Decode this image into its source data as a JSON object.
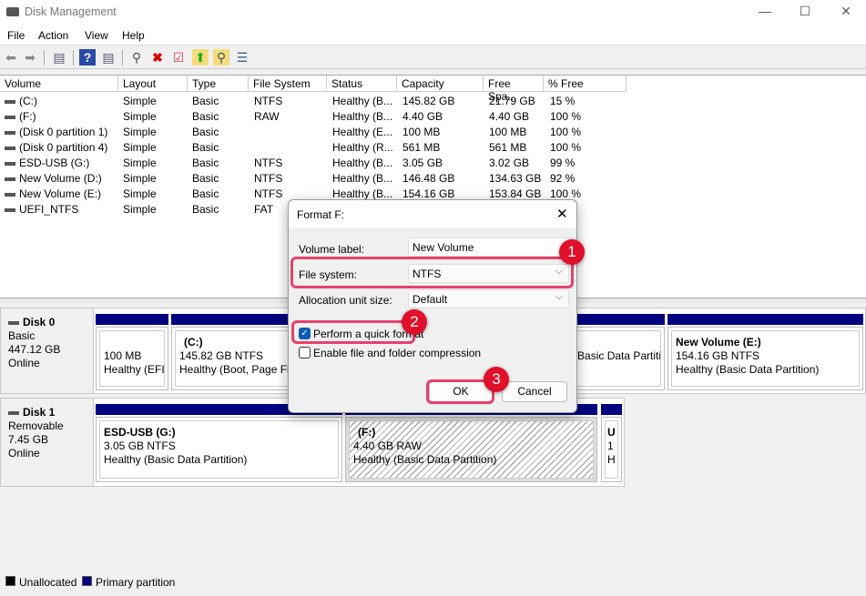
{
  "window": {
    "title": "Disk Management",
    "minimize": "—",
    "maximize": "☐",
    "close": "✕"
  },
  "menu": [
    "File",
    "Action",
    "View",
    "Help"
  ],
  "toolbar": [
    "back-icon",
    "forward-icon",
    "console-tree-icon",
    "help-icon",
    "action-pane-icon",
    "connect-disk-icon",
    "delete-icon",
    "properties-icon",
    "open-folder-icon",
    "explore-icon",
    "list-icon"
  ],
  "columns": [
    "Volume",
    "Layout",
    "Type",
    "File System",
    "Status",
    "Capacity",
    "Free Spa...",
    "% Free"
  ],
  "volumes": [
    [
      "(C:)",
      "Simple",
      "Basic",
      "NTFS",
      "Healthy (B...",
      "145.82 GB",
      "21.79 GB",
      "15 %"
    ],
    [
      "(F:)",
      "Simple",
      "Basic",
      "RAW",
      "Healthy (B...",
      "4.40 GB",
      "4.40 GB",
      "100 %"
    ],
    [
      "(Disk 0 partition 1)",
      "Simple",
      "Basic",
      "",
      "Healthy (E...",
      "100 MB",
      "100 MB",
      "100 %"
    ],
    [
      "(Disk 0 partition 4)",
      "Simple",
      "Basic",
      "",
      "Healthy (R...",
      "561 MB",
      "561 MB",
      "100 %"
    ],
    [
      "ESD-USB (G:)",
      "Simple",
      "Basic",
      "NTFS",
      "Healthy (B...",
      "3.05 GB",
      "3.02 GB",
      "99 %"
    ],
    [
      "New Volume (D:)",
      "Simple",
      "Basic",
      "NTFS",
      "Healthy (B...",
      "146.48 GB",
      "134.63 GB",
      "92 %"
    ],
    [
      "New Volume (E:)",
      "Simple",
      "Basic",
      "NTFS",
      "Healthy (B...",
      "154.16 GB",
      "153.84 GB",
      "100 %"
    ],
    [
      "UEFI_NTFS",
      "Simple",
      "Basic",
      "FAT",
      "Healthy (B...",
      "",
      "",
      ""
    ]
  ],
  "disks": [
    {
      "name": "Disk 0",
      "type": "Basic",
      "size": "447.12 GB",
      "state": "Online",
      "partitions": [
        {
          "title": "",
          "size": "100 MB",
          "status": "Healthy (EFI System Partition)"
        },
        {
          "title": "(C:)",
          "size": "145.82 GB NTFS",
          "status": "Healthy (Boot, Page File"
        },
        {
          "title": "",
          "size": "",
          "status": "Healthy (Basic Data Partition)"
        },
        {
          "title": "New Volume  (E:)",
          "size": "154.16 GB NTFS",
          "status": "Healthy (Basic Data Partition)"
        }
      ]
    },
    {
      "name": "Disk 1",
      "type": "Removable",
      "size": "7.45 GB",
      "state": "Online",
      "partitions": [
        {
          "title": "ESD-USB  (G:)",
          "size": "3.05 GB NTFS",
          "status": "Healthy (Basic Data Partition)"
        },
        {
          "title": "(F:)",
          "size": "4.40 GB RAW",
          "status": "Healthy (Basic Data Partition)"
        },
        {
          "title": "U",
          "size": "1",
          "status": "H"
        }
      ]
    }
  ],
  "legend": [
    {
      "label": "Unallocated",
      "color": "#000000"
    },
    {
      "label": "Primary partition",
      "color": "#000080"
    }
  ],
  "dialog": {
    "title": "Format F:",
    "close": "✕",
    "volume_label": "Volume label:",
    "volume_value": "New Volume",
    "fs_label": "File system:",
    "fs_value": "NTFS",
    "alloc_label": "Allocation unit size:",
    "alloc_value": "Default",
    "quick_format": "Perform a quick format",
    "quick_checked": true,
    "compression": "Enable file and folder compression",
    "compression_checked": false,
    "ok": "OK",
    "cancel": "Cancel"
  },
  "annotations": [
    "1",
    "2",
    "3"
  ],
  "colors": {
    "highlight": "#e8416c",
    "badge": "#e0102a",
    "partition_bar": "#000080"
  }
}
